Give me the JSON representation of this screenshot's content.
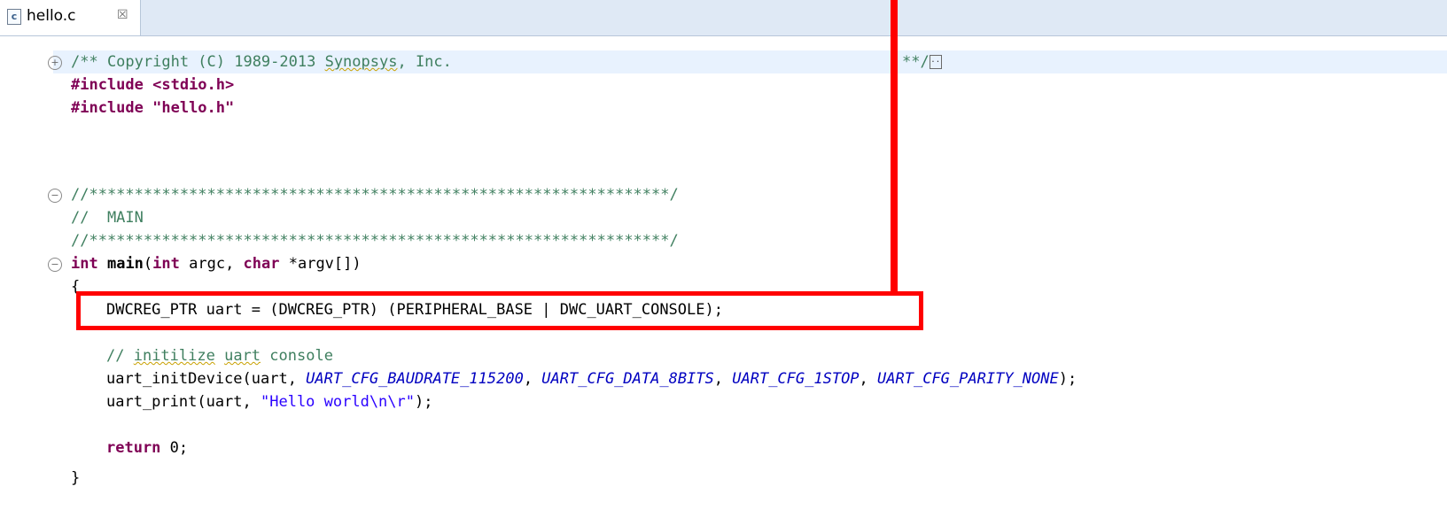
{
  "tab": {
    "file_icon_letter": "c",
    "file_name": "hello.c",
    "close_glyph": "☒"
  },
  "code": {
    "copyright_comment": "/** Copyright (C) 1989-2013 ",
    "synopsys": "Synopsys",
    "copyright_tail": ", Inc.",
    "copyright_end": "**/",
    "collapsed_marker": "..",
    "include_kw": "#include",
    "include_1": " <stdio.h>",
    "include_2": " \"hello.h\"",
    "separator": "//****************************************************************/",
    "main_comment": "//  MAIN",
    "int_kw": "int",
    "main_name": "main",
    "main_open": "(",
    "char_kw": "char",
    "main_args_1": " argc, ",
    "main_args_2": " *argv[])",
    "open_brace": "{",
    "uart_decl": "DWCREG_PTR uart = (DWCREG_PTR) (PERIPHERAL_BASE | DWC_UART_CONSOLE);",
    "init_comment_prefix": "// ",
    "initilize": "initilize",
    "init_space": " ",
    "uart_word": "uart",
    "init_comment_suffix": " console",
    "init_call_prefix": "uart_initDevice(uart, ",
    "const_baud": "UART_CFG_BAUDRATE_115200",
    "const_data": "UART_CFG_DATA_8BITS",
    "const_stop": "UART_CFG_1STOP",
    "const_parity": "UART_CFG_PARITY_NONE",
    "sep_comma": ", ",
    "init_call_suffix": ");",
    "print_prefix": "uart_print(uart, ",
    "print_string": "\"Hello world\\n\\r\"",
    "print_suffix": ");",
    "return_kw": "return",
    "return_value": " 0;",
    "close_brace": "}"
  },
  "gutter": {
    "expand_glyph": "+",
    "collapse_glyph": "−"
  },
  "colors": {
    "keyword": "#7f0055",
    "comment": "#3f7f5f",
    "string": "#2a00ff",
    "constant": "#0000c0",
    "annotation": "#ff0000"
  }
}
